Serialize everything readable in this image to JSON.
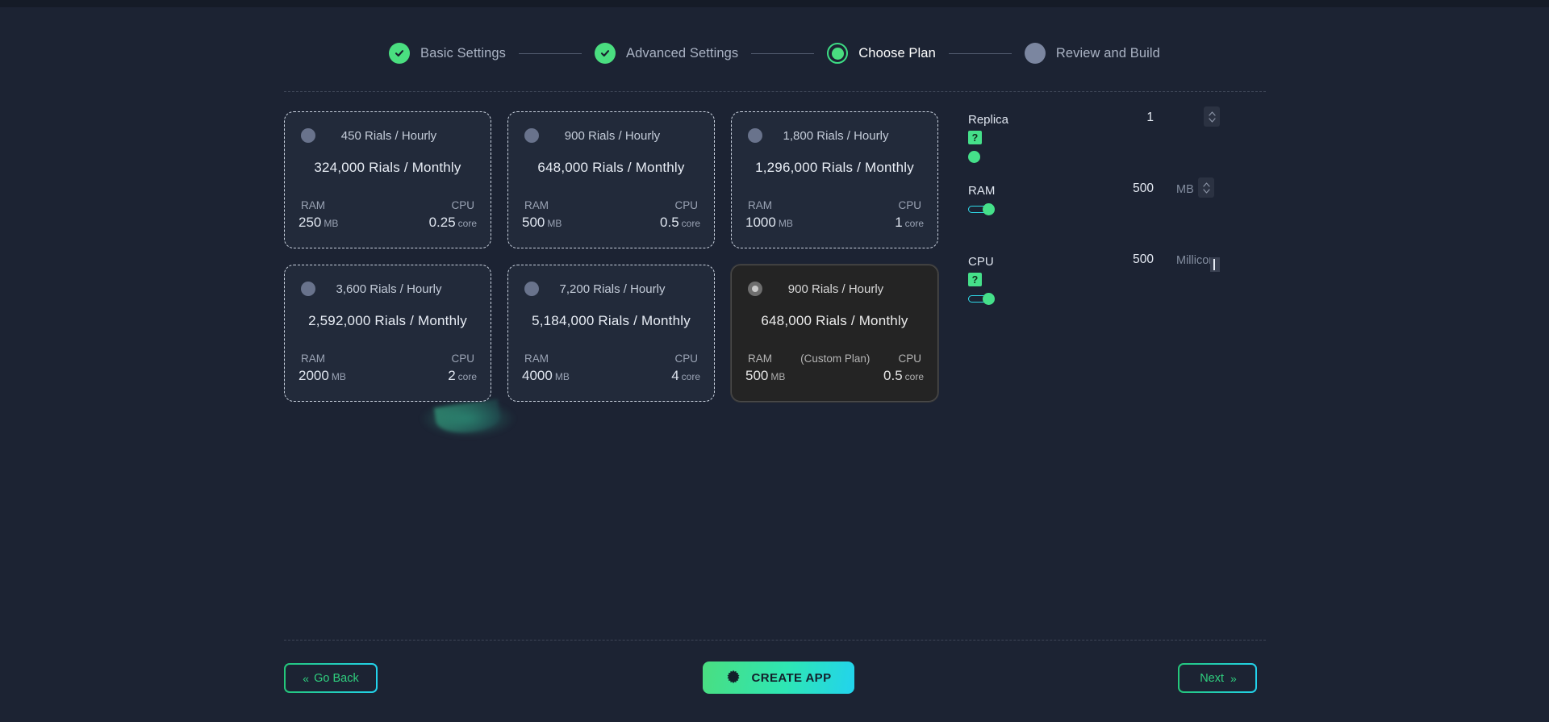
{
  "stepper": {
    "steps": [
      {
        "label": "Basic Settings",
        "state": "done"
      },
      {
        "label": "Advanced Settings",
        "state": "done"
      },
      {
        "label": "Choose Plan",
        "state": "current"
      },
      {
        "label": "Review and Build",
        "state": "pending"
      }
    ]
  },
  "plans": [
    {
      "hourly": "450 Rials / Hourly",
      "monthly": "324,000 Rials / Monthly",
      "ram_head": "RAM",
      "ram_value": "250",
      "ram_unit": "MB",
      "cpu_head": "CPU",
      "cpu_value": "0.25",
      "cpu_unit": "core",
      "selected": false,
      "custom_tag": ""
    },
    {
      "hourly": "900 Rials / Hourly",
      "monthly": "648,000 Rials / Monthly",
      "ram_head": "RAM",
      "ram_value": "500",
      "ram_unit": "MB",
      "cpu_head": "CPU",
      "cpu_value": "0.5",
      "cpu_unit": "core",
      "selected": false,
      "custom_tag": ""
    },
    {
      "hourly": "1,800 Rials / Hourly",
      "monthly": "1,296,000 Rials / Monthly",
      "ram_head": "RAM",
      "ram_value": "1000",
      "ram_unit": "MB",
      "cpu_head": "CPU",
      "cpu_value": "1",
      "cpu_unit": "core",
      "selected": false,
      "custom_tag": ""
    },
    {
      "hourly": "3,600 Rials / Hourly",
      "monthly": "2,592,000 Rials / Monthly",
      "ram_head": "RAM",
      "ram_value": "2000",
      "ram_unit": "MB",
      "cpu_head": "CPU",
      "cpu_value": "2",
      "cpu_unit": "core",
      "selected": false,
      "custom_tag": ""
    },
    {
      "hourly": "7,200 Rials / Hourly",
      "monthly": "5,184,000 Rials / Monthly",
      "ram_head": "RAM",
      "ram_value": "4000",
      "ram_unit": "MB",
      "cpu_head": "CPU",
      "cpu_value": "4",
      "cpu_unit": "core",
      "selected": false,
      "custom_tag": ""
    },
    {
      "hourly": "900 Rials / Hourly",
      "monthly": "648,000 Rials / Monthly",
      "ram_head": "RAM",
      "ram_value": "500",
      "ram_unit": "MB",
      "cpu_head": "CPU",
      "cpu_value": "0.5",
      "cpu_unit": "core",
      "selected": true,
      "custom_tag": "(Custom Plan)"
    }
  ],
  "resources": [
    {
      "label": "Replica",
      "help": "?",
      "value": "1",
      "unit": "",
      "has_help_badge": true,
      "has_track": false,
      "has_stepper": true
    },
    {
      "label": "RAM",
      "help": "",
      "value": "500",
      "unit": "MB",
      "has_help_badge": false,
      "has_track": true,
      "has_stepper": true
    },
    {
      "label": "CPU",
      "help": "?",
      "value": "500",
      "unit": "Millicore",
      "has_help_badge": true,
      "has_track": true,
      "has_stepper": false
    }
  ],
  "footer": {
    "go_back": "Go Back",
    "go_back_chevron": "«",
    "create_app": "CREATE APP",
    "next": "Next",
    "next_chevron": "»"
  },
  "colors": {
    "background": "#1c2333",
    "accent_green": "#4ade80",
    "accent_cyan": "#22d3ee",
    "card_bg": "#222a3a",
    "selected_card_bg": "#242424"
  }
}
